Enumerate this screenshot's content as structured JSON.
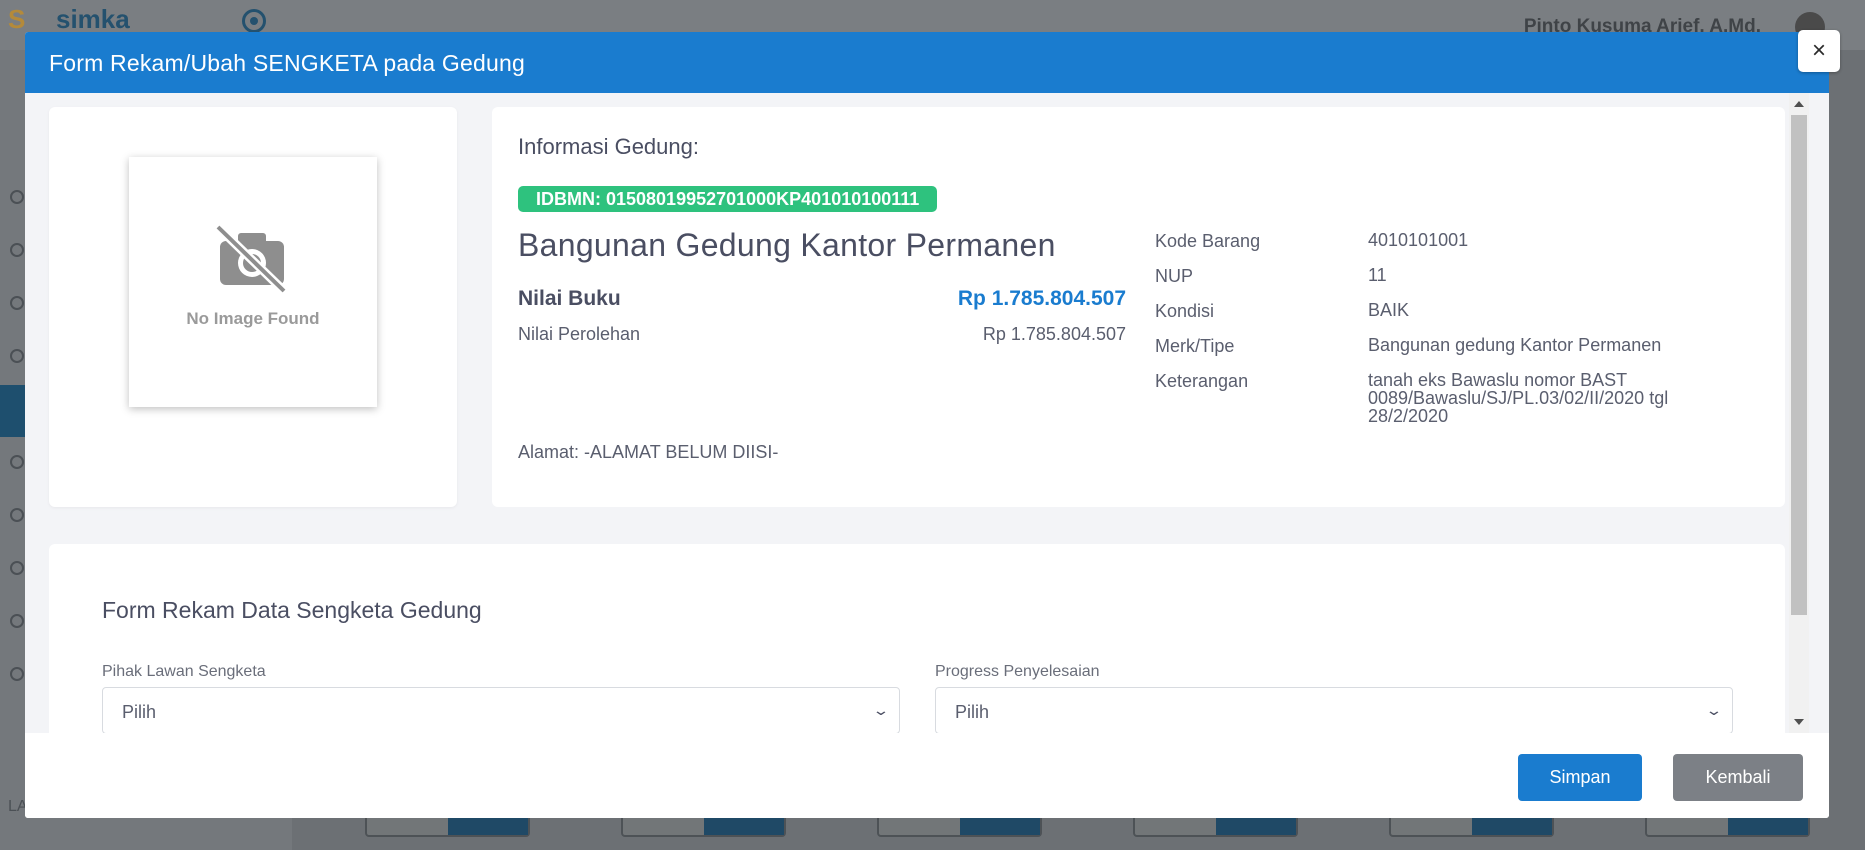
{
  "background": {
    "logo_text": "simka",
    "user_name": "Pinto Kusuma Arief, A.Md.",
    "sidebar_label": "LA"
  },
  "modal": {
    "title": "Form Rekam/Ubah SENGKETA pada Gedung",
    "close_label": "×",
    "image_placeholder": "No Image Found",
    "info": {
      "heading": "Informasi Gedung:",
      "idbmn": "IDBMN: 01508019952701000KP401010100111",
      "building_name": "Bangunan Gedung Kantor Permanen",
      "nilai_buku_label": "Nilai Buku",
      "nilai_buku_value": "Rp 1.785.804.507",
      "nilai_perolehan_label": "Nilai Perolehan",
      "nilai_perolehan_value": "Rp 1.785.804.507",
      "alamat": "Alamat: -ALAMAT BELUM DIISI-",
      "specs": [
        {
          "key": "Kode Barang",
          "value": "4010101001"
        },
        {
          "key": "NUP",
          "value": "11"
        },
        {
          "key": "Kondisi",
          "value": "BAIK"
        },
        {
          "key": "Merk/Tipe",
          "value": "Bangunan gedung Kantor Permanen"
        },
        {
          "key": "Keterangan",
          "value": "tanah eks Bawaslu nomor BAST 0089/Bawaslu/SJ/PL.03/02/II/2020 tgl 28/2/2020"
        }
      ]
    },
    "form": {
      "title": "Form Rekam Data Sengketa Gedung",
      "pihak_label": "Pihak Lawan Sengketa",
      "pihak_value": "Pilih",
      "progress_label": "Progress Penyelesaian",
      "progress_value": "Pilih"
    },
    "footer": {
      "save_label": "Simpan",
      "back_label": "Kembali"
    }
  },
  "colors": {
    "primary": "#1a7ccf",
    "success_badge": "#2ec27e",
    "secondary_button": "#7c8086"
  }
}
